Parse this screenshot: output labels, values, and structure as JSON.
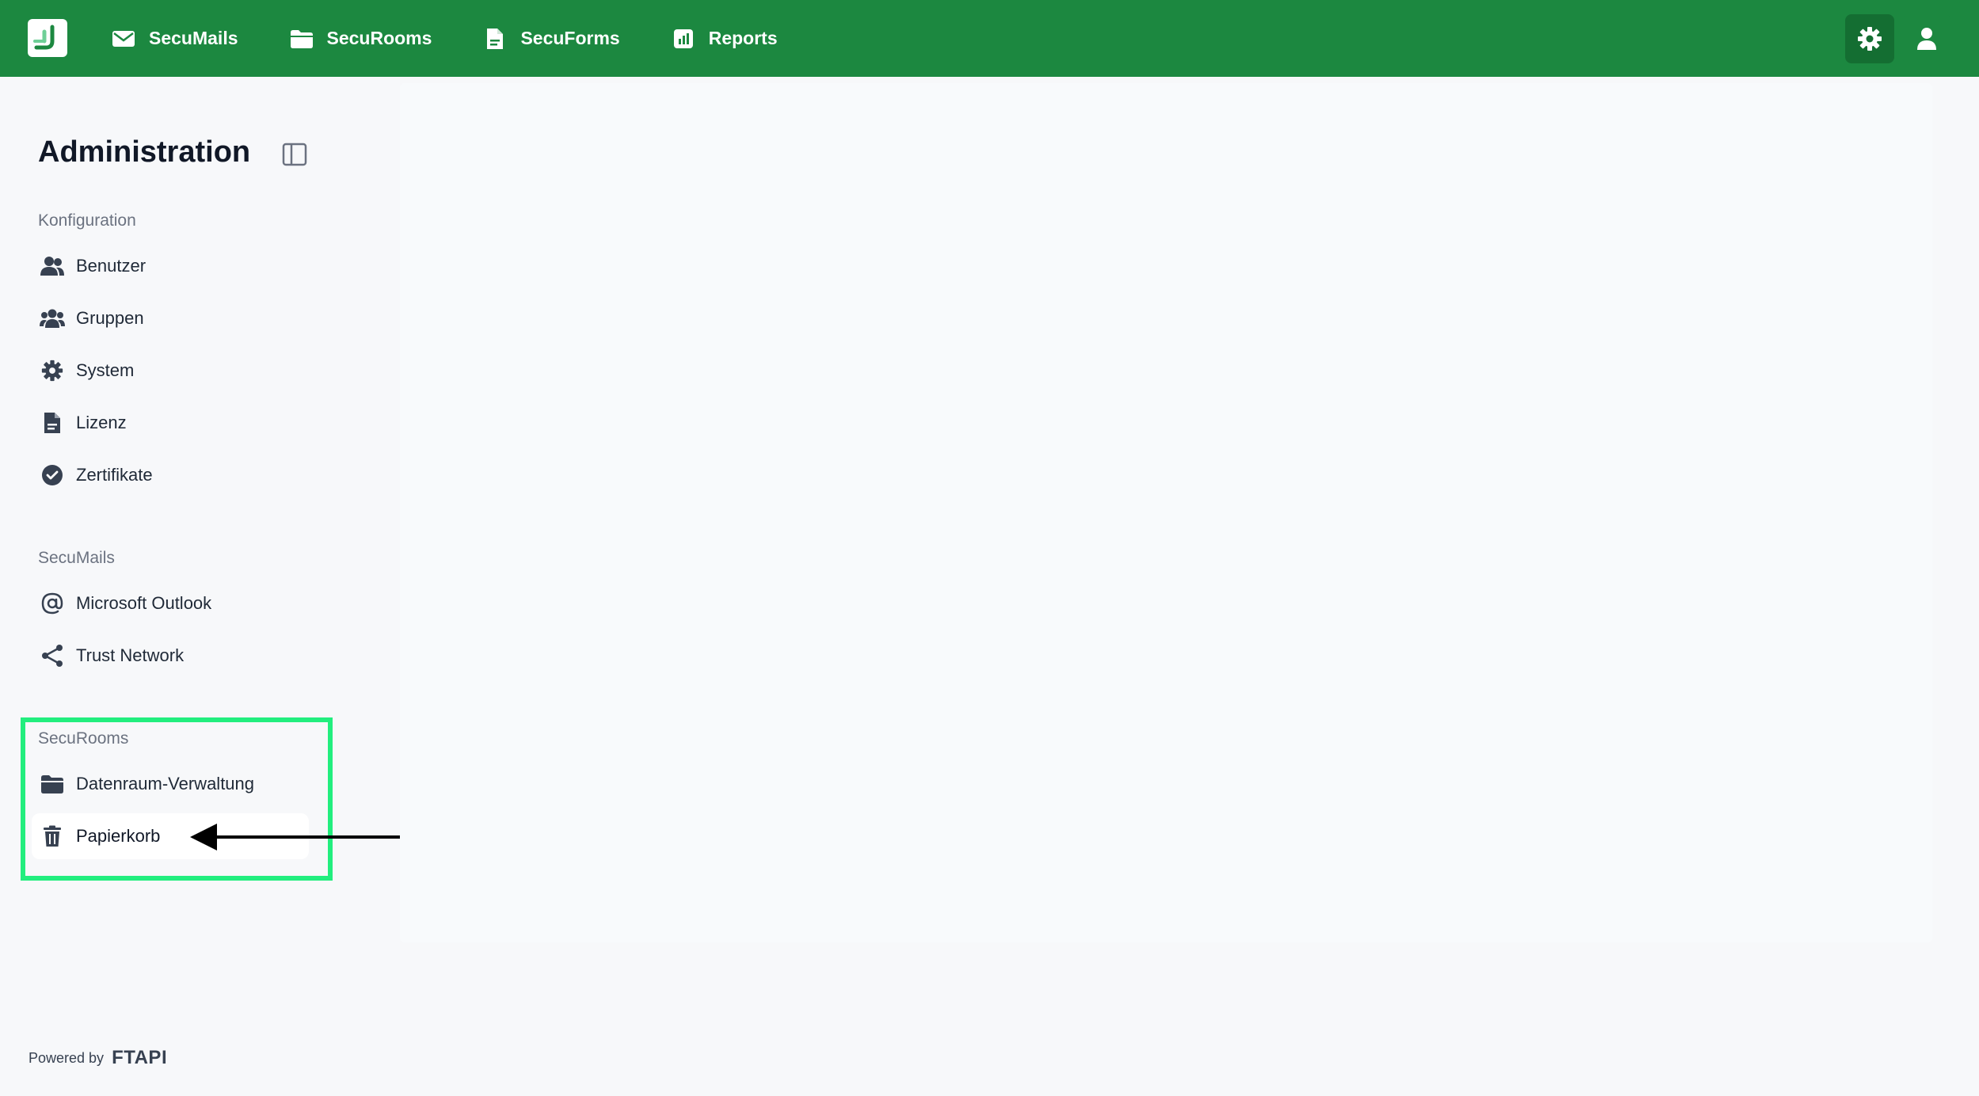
{
  "topbar": {
    "brand_color": "#1c8840",
    "nav": [
      {
        "label": "SecuMails",
        "icon": "envelope-icon"
      },
      {
        "label": "SecuRooms",
        "icon": "folder-icon"
      },
      {
        "label": "SecuForms",
        "icon": "document-icon"
      },
      {
        "label": "Reports",
        "icon": "bar-chart-icon"
      }
    ],
    "actions": [
      {
        "icon": "gear-icon"
      },
      {
        "icon": "user-icon"
      }
    ]
  },
  "sidebar": {
    "title": "Administration",
    "sections": [
      {
        "label": "Konfiguration",
        "items": [
          {
            "label": "Benutzer",
            "icon": "user-pair-icon"
          },
          {
            "label": "Gruppen",
            "icon": "users-group-icon"
          },
          {
            "label": "System",
            "icon": "gear-icon"
          },
          {
            "label": "Lizenz",
            "icon": "document-icon"
          },
          {
            "label": "Zertifikate",
            "icon": "check-badge-icon"
          }
        ]
      },
      {
        "label": "SecuMails",
        "items": [
          {
            "label": "Microsoft Outlook",
            "icon": "at-sign-icon"
          },
          {
            "label": "Trust Network",
            "icon": "share-icon"
          }
        ]
      },
      {
        "label": "SecuRooms",
        "items": [
          {
            "label": "Datenraum-Verwaltung",
            "icon": "folder-icon"
          },
          {
            "label": "Papierkorb",
            "icon": "trash-icon",
            "active": true
          }
        ]
      }
    ],
    "highlight_color": "#22ee7e"
  },
  "footer": {
    "powered_by": "Powered by",
    "brand": "FTAPI"
  }
}
